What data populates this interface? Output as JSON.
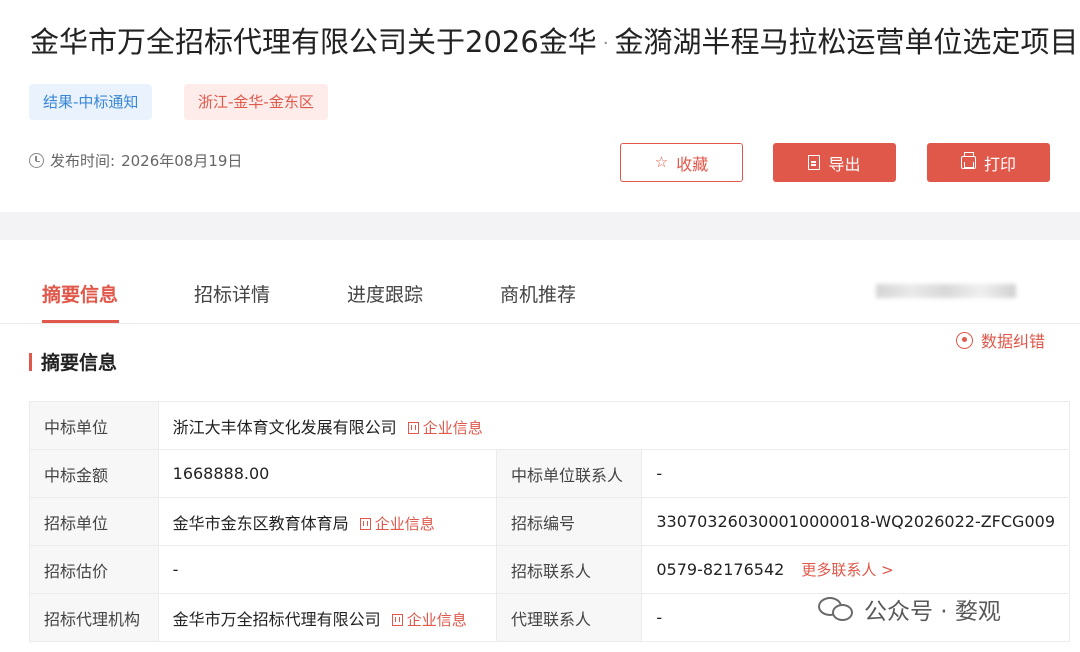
{
  "header": {
    "title_part1": "金华市万全招标代理有限公司关于2026金华",
    "title_sep": "·",
    "title_part2": "金漪湖半程马拉松运营单位选定项目中",
    "tag_result": "结果-中标通知",
    "tag_region": "浙江-金华-金东区",
    "publish_label": "发布时间:",
    "publish_date": "2026年08月19日"
  },
  "actions": {
    "favorite": "收藏",
    "export": "导出",
    "print": "打印"
  },
  "tabs": [
    "摘要信息",
    "招标详情",
    "进度跟踪",
    "商机推荐"
  ],
  "correction": "数据纠错",
  "section_title": "摘要信息",
  "company_link": "企业信息",
  "more_contacts": "更多联系人 >",
  "table": {
    "winner_label": "中标单位",
    "winner": "浙江大丰体育文化发展有限公司",
    "amount_label": "中标金额",
    "amount": "1668888.00",
    "winner_contact_label": "中标单位联系人",
    "winner_contact": "-",
    "tenderer_label": "招标单位",
    "tenderer": "金华市金东区教育体育局",
    "bid_no_label": "招标编号",
    "bid_no": "330703260300010000018-WQ2026022-ZFCG009",
    "estimate_label": "招标估价",
    "estimate": "-",
    "tender_contact_label": "招标联系人",
    "tender_contact": "0579-82176542",
    "agency_label": "招标代理机构",
    "agency": "金华市万全招标代理有限公司",
    "agent_contact_label": "代理联系人",
    "agent_contact": "-"
  },
  "watermark": "公众号 · 婺观"
}
